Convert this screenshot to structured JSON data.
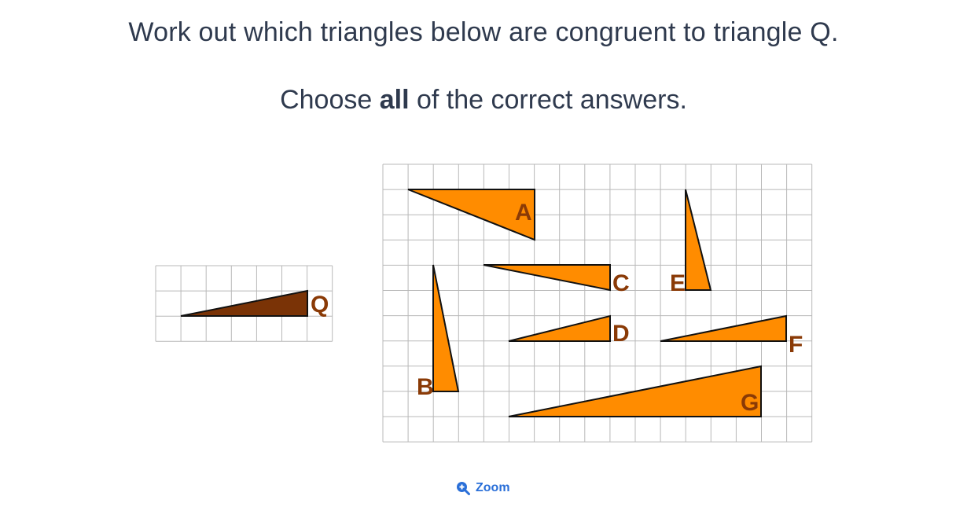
{
  "question": {
    "line1": "Work out which triangles below are congruent to triangle Q.",
    "line2_before": "Choose ",
    "line2_bold": "all",
    "line2_after": " of the correct answers."
  },
  "reference_triangle": {
    "label": "Q",
    "color": "#7a3306"
  },
  "triangles": [
    {
      "label": "A",
      "color": "#ff8c00"
    },
    {
      "label": "B",
      "color": "#ff8c00"
    },
    {
      "label": "C",
      "color": "#ff8c00"
    },
    {
      "label": "D",
      "color": "#ff8c00"
    },
    {
      "label": "E",
      "color": "#ff8c00"
    },
    {
      "label": "F",
      "color": "#ff8c00"
    },
    {
      "label": "G",
      "color": "#ff8c00"
    }
  ],
  "label_color": "#8a3a06",
  "zoom": {
    "label": "Zoom",
    "icon": "zoom-in-icon",
    "color": "#2a6fd8"
  }
}
